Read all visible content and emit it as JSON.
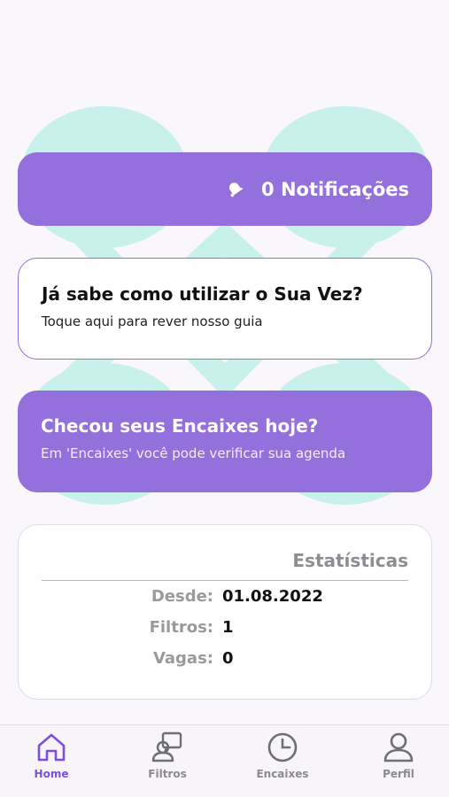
{
  "colors": {
    "accent": "#9370dc",
    "active_tab": "#7c4fe0",
    "background_shape": "#c6f0ea"
  },
  "notifications": {
    "icon": "bell-icon",
    "label": "0 Notificações"
  },
  "guide_card": {
    "title": "Já sabe como utilizar o Sua Vez?",
    "subtitle": "Toque aqui para rever nosso guia"
  },
  "encaixes_card": {
    "title": "Checou seus Encaixes hoje?",
    "subtitle": "Em 'Encaixes' você pode verificar sua agenda"
  },
  "stats": {
    "title": "Estatísticas",
    "rows": [
      {
        "label": "Desde:",
        "value": "01.08.2022"
      },
      {
        "label": "Filtros:",
        "value": "1"
      },
      {
        "label": "Vagas:",
        "value": "0"
      }
    ]
  },
  "tabbar": {
    "items": [
      {
        "label": "Home",
        "icon": "home-icon",
        "active": true
      },
      {
        "label": "Filtros",
        "icon": "filter-icon",
        "active": false
      },
      {
        "label": "Encaixes",
        "icon": "clock-icon",
        "active": false
      },
      {
        "label": "Perfil",
        "icon": "user-icon",
        "active": false
      }
    ]
  }
}
